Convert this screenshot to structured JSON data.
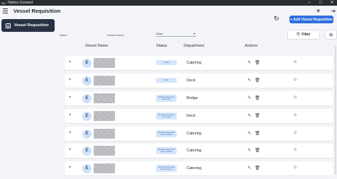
{
  "titlebar": {
    "app_name": "Harbor Connect",
    "app_icon": "HC",
    "minimize": "–",
    "maximize": "□",
    "close": "✕"
  },
  "header": {
    "menu_icon": "hamburger-menu-icon",
    "title": "Vessel Requisition",
    "theme_icon": "☀",
    "logout_icon": "⇥"
  },
  "sidebar": {
    "items": [
      {
        "label": "Vessel Requisition",
        "icon": "requisition-icon",
        "active": true
      }
    ]
  },
  "toolbar": {
    "refresh_icon": "↻",
    "add_button": "+ Add Vessel Requisition",
    "filter_button": "Filter",
    "filter_icon": "⛉",
    "view_icon": "⊞"
  },
  "filters": {
    "name_label": "Name",
    "vessel_name_label": "Vessel Name",
    "dept_select_value": "Deck",
    "chevron": "▾"
  },
  "table": {
    "headers": [
      "Vessel Name",
      "Status",
      "Department",
      "Actions"
    ],
    "rows": [
      {
        "avatar": "E",
        "status": "Draft",
        "department": "Catering"
      },
      {
        "avatar": "E",
        "status": "Draft",
        "department": "Deck"
      },
      {
        "avatar": "E",
        "status": "Pending Approval From AM",
        "department": "Bridge"
      },
      {
        "avatar": "E",
        "status": "Pending Approval From AM",
        "department": "Deck"
      },
      {
        "avatar": "E",
        "status": "Pending Approval From Master",
        "department": "Catering"
      },
      {
        "avatar": "E",
        "status": "Pending Approval From Master",
        "department": "Catering"
      },
      {
        "avatar": "E",
        "status": "Pending Approval From Master",
        "department": "Catering"
      }
    ],
    "row_icons": {
      "pin": "⌖",
      "edit": "✎",
      "delete": "🗑",
      "message": "☺"
    }
  },
  "colors": {
    "accent": "#2f6fe0",
    "sidebar_active": "#283244",
    "status_bg": "#d5e6fb",
    "avatar_bg": "#cfe1f7"
  }
}
